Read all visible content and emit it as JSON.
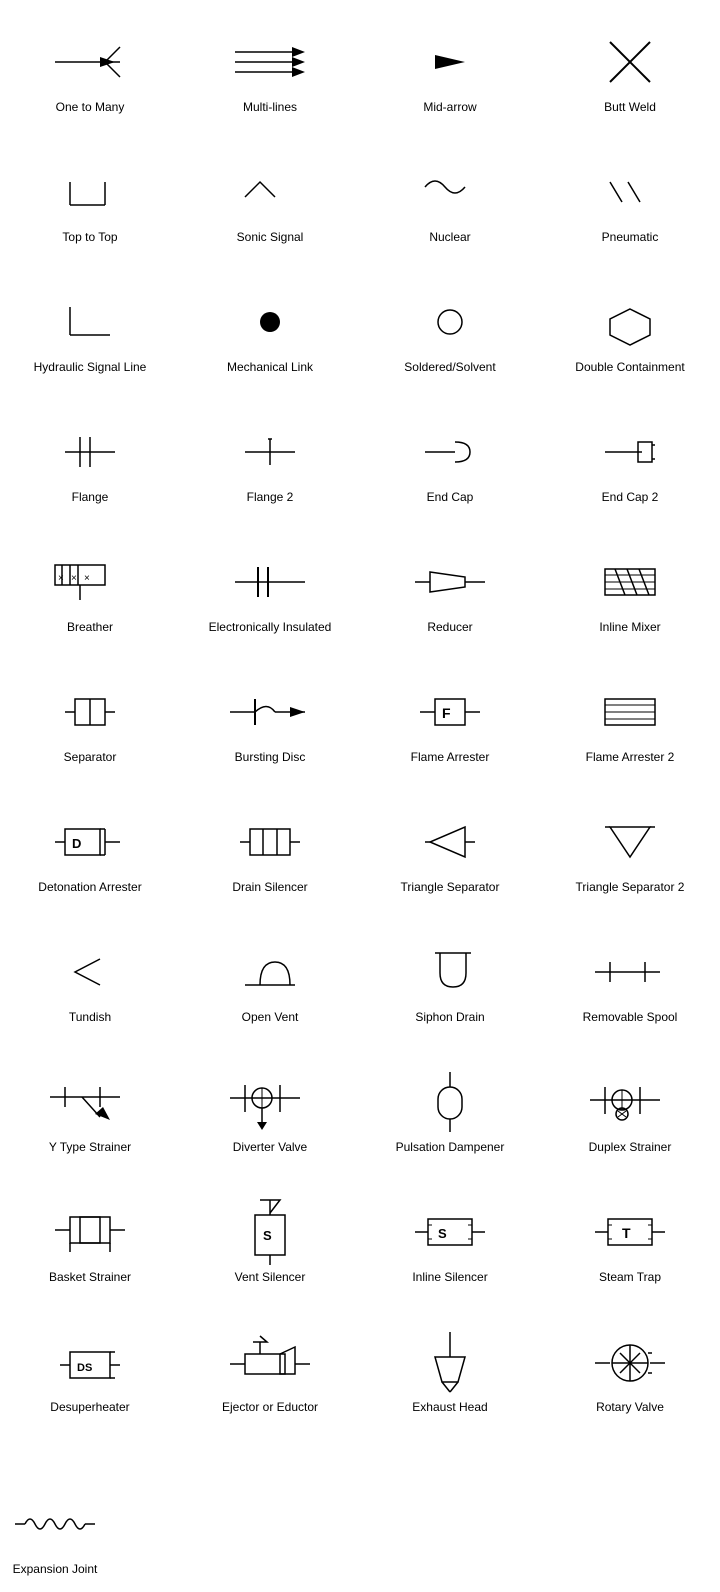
{
  "items": [
    {
      "id": "one-to-many",
      "label": "One to Many"
    },
    {
      "id": "multi-lines",
      "label": "Multi-lines"
    },
    {
      "id": "mid-arrow",
      "label": "Mid-arrow"
    },
    {
      "id": "butt-weld",
      "label": "Butt Weld"
    },
    {
      "id": "top-to-top",
      "label": "Top to Top"
    },
    {
      "id": "sonic-signal",
      "label": "Sonic Signal"
    },
    {
      "id": "nuclear",
      "label": "Nuclear"
    },
    {
      "id": "pneumatic",
      "label": "Pneumatic"
    },
    {
      "id": "hydraulic-signal-line",
      "label": "Hydraulic Signal Line"
    },
    {
      "id": "mechanical-link",
      "label": "Mechanical Link"
    },
    {
      "id": "soldered-solvent",
      "label": "Soldered/Solvent"
    },
    {
      "id": "double-containment",
      "label": "Double Containment"
    },
    {
      "id": "flange",
      "label": "Flange"
    },
    {
      "id": "flange-2",
      "label": "Flange 2"
    },
    {
      "id": "end-cap",
      "label": "End Cap"
    },
    {
      "id": "end-cap-2",
      "label": "End Cap 2"
    },
    {
      "id": "breather",
      "label": "Breather"
    },
    {
      "id": "electronically-insulated",
      "label": "Electronically Insulated"
    },
    {
      "id": "reducer",
      "label": "Reducer"
    },
    {
      "id": "inline-mixer",
      "label": "Inline Mixer"
    },
    {
      "id": "separator",
      "label": "Separator"
    },
    {
      "id": "bursting-disc",
      "label": "Bursting Disc"
    },
    {
      "id": "flame-arrester",
      "label": "Flame Arrester"
    },
    {
      "id": "flame-arrester-2",
      "label": "Flame Arrester 2"
    },
    {
      "id": "detonation-arrester",
      "label": "Detonation Arrester"
    },
    {
      "id": "drain-silencer",
      "label": "Drain Silencer"
    },
    {
      "id": "triangle-separator",
      "label": "Triangle Separator"
    },
    {
      "id": "triangle-separator-2",
      "label": "Triangle Separator 2"
    },
    {
      "id": "tundish",
      "label": "Tundish"
    },
    {
      "id": "open-vent",
      "label": "Open Vent"
    },
    {
      "id": "siphon-drain",
      "label": "Siphon Drain"
    },
    {
      "id": "removable-spool",
      "label": "Removable Spool"
    },
    {
      "id": "y-type-strainer",
      "label": "Y Type Strainer"
    },
    {
      "id": "diverter-valve",
      "label": "Diverter Valve"
    },
    {
      "id": "pulsation-dampener",
      "label": "Pulsation Dampener"
    },
    {
      "id": "duplex-strainer",
      "label": "Duplex Strainer"
    },
    {
      "id": "basket-strainer",
      "label": "Basket Strainer"
    },
    {
      "id": "vent-silencer",
      "label": "Vent Silencer"
    },
    {
      "id": "inline-silencer",
      "label": "Inline Silencer"
    },
    {
      "id": "steam-trap",
      "label": "Steam Trap"
    },
    {
      "id": "desuperheater",
      "label": "Desuperheater"
    },
    {
      "id": "ejector-or-eductor",
      "label": "Ejector or Eductor"
    },
    {
      "id": "exhaust-head",
      "label": "Exhaust Head"
    },
    {
      "id": "rotary-valve",
      "label": "Rotary Valve"
    },
    {
      "id": "expansion-joint",
      "label": "Expansion Joint"
    }
  ]
}
